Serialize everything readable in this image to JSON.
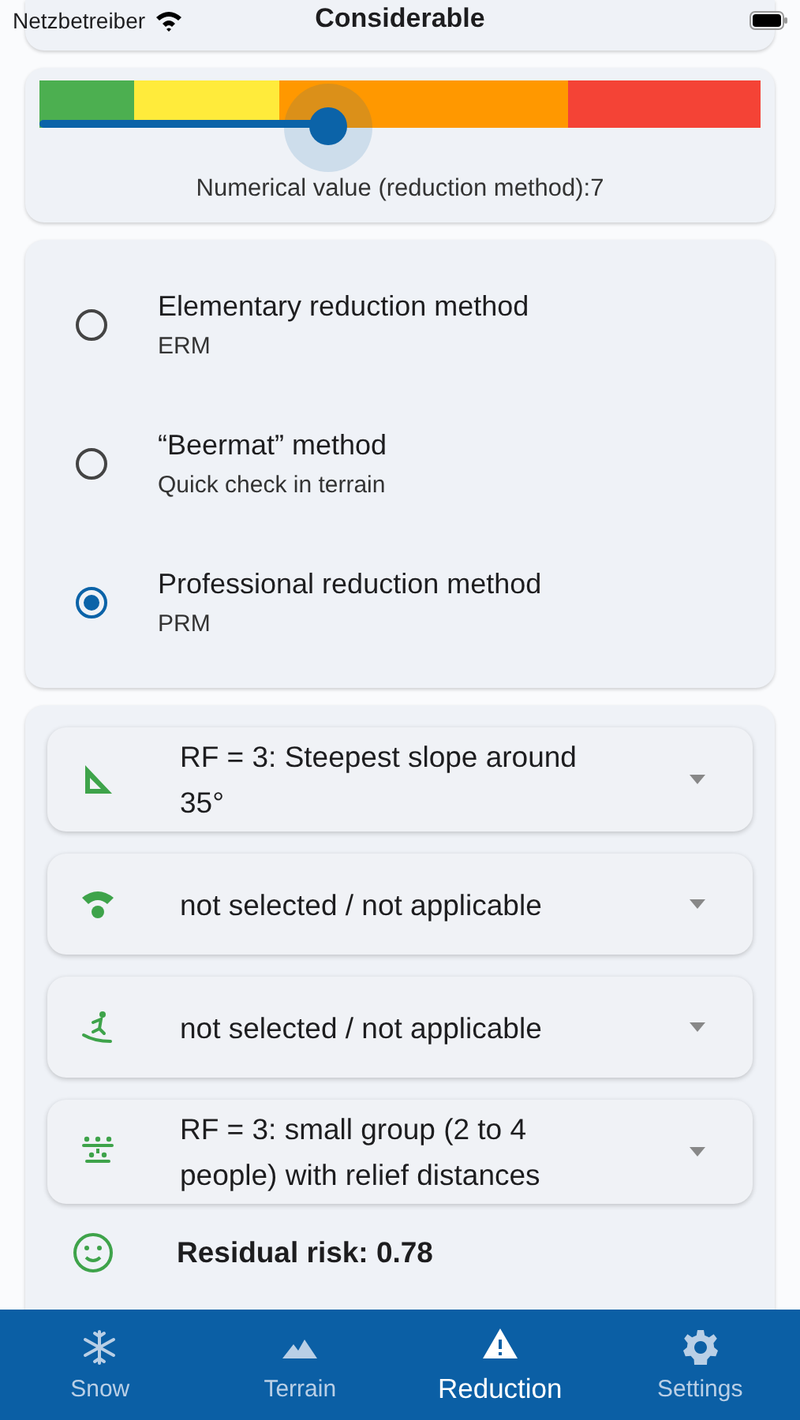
{
  "status_bar": {
    "carrier": "Netzbetreiber"
  },
  "danger_card": {
    "title": "Considerable"
  },
  "slider": {
    "level": 0.4,
    "caption": "Numerical value (reduction method):7"
  },
  "methods": [
    {
      "title": "Elementary reduction method",
      "subtitle": "ERM",
      "selected": false
    },
    {
      "title": "“Beermat” method",
      "subtitle": "Quick check in terrain",
      "selected": false
    },
    {
      "title": "Professional reduction method",
      "subtitle": "PRM",
      "selected": true
    }
  ],
  "factors": [
    {
      "kind": "slope",
      "value": "RF = 3: Steepest slope around 35°"
    },
    {
      "kind": "signal",
      "value": "not selected / not applicable"
    },
    {
      "kind": "skier",
      "value": "not selected / not applicable"
    },
    {
      "kind": "group",
      "value": "RF = 3: small group (2 to 4 people) with relief distances"
    }
  ],
  "result": {
    "label": "Residual risk: 0.78"
  },
  "tabs": [
    {
      "kind": "snow",
      "label": "Snow",
      "selected": false
    },
    {
      "kind": "terrain",
      "label": "Terrain",
      "selected": false
    },
    {
      "kind": "warning",
      "label": "Reduction",
      "selected": true
    },
    {
      "kind": "settings",
      "label": "Settings",
      "selected": false
    }
  ]
}
